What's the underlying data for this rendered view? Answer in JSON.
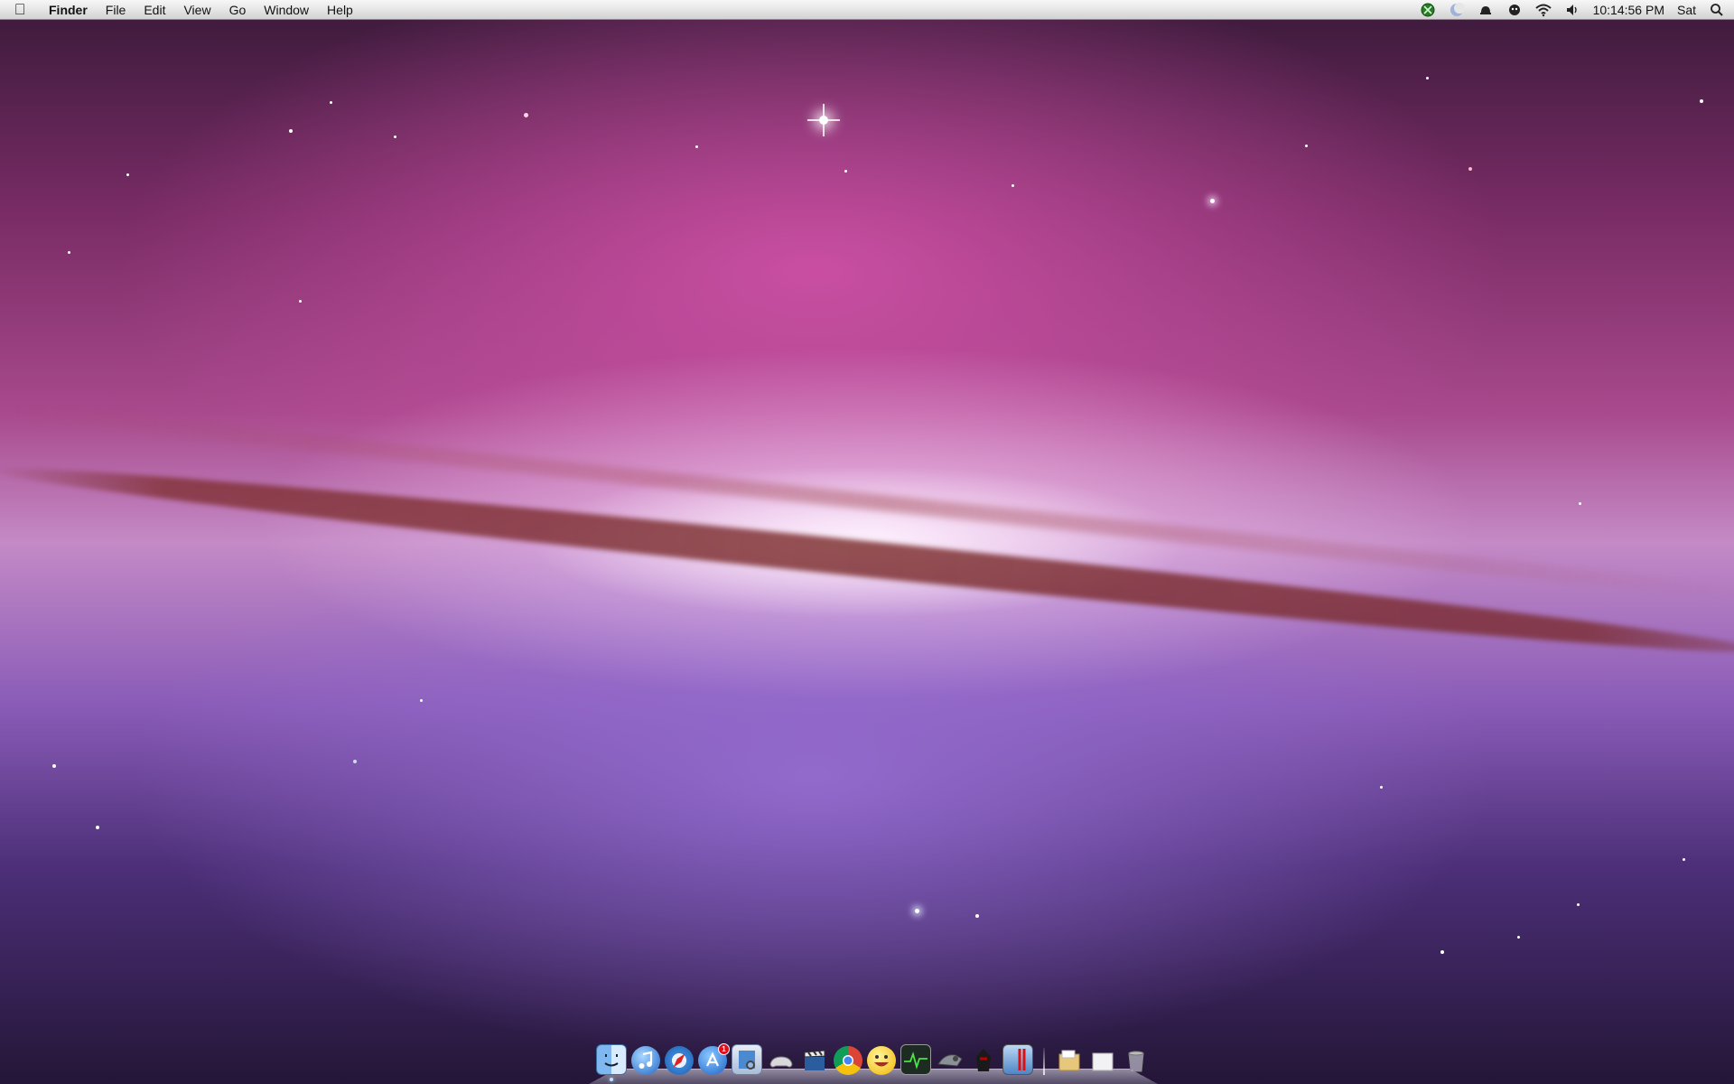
{
  "menubar": {
    "apple_icon": "apple-logo-icon",
    "app_name": "Finder",
    "menus": [
      "File",
      "Edit",
      "View",
      "Go",
      "Window",
      "Help"
    ],
    "status_icons": [
      "xbox-controller-icon",
      "moon-icon",
      "time-machine-icon",
      "skype-icon",
      "wifi-icon",
      "volume-icon"
    ],
    "clock": "10:14:56 PM",
    "day": "Sat",
    "spotlight_icon": "spotlight-search-icon"
  },
  "dock": {
    "apps": [
      {
        "name": "Finder",
        "icon": "finder-icon",
        "running": true
      },
      {
        "name": "iTunes",
        "icon": "itunes-icon",
        "running": false
      },
      {
        "name": "Safari",
        "icon": "safari-icon",
        "running": false
      },
      {
        "name": "App Store",
        "icon": "app-store-icon",
        "running": false,
        "badge": "1"
      },
      {
        "name": "Preview",
        "icon": "preview-icon",
        "running": false
      },
      {
        "name": "Game Controller",
        "icon": "game-controller-icon",
        "running": false
      },
      {
        "name": "Movie",
        "icon": "clapperboard-icon",
        "running": false
      },
      {
        "name": "Google Chrome",
        "icon": "chrome-icon",
        "running": false
      },
      {
        "name": "Adium",
        "icon": "smiley-icon",
        "running": false
      },
      {
        "name": "Activity Monitor",
        "icon": "activity-monitor-icon",
        "running": false
      },
      {
        "name": "Steam",
        "icon": "steam-icon",
        "running": false
      },
      {
        "name": "Game",
        "icon": "assassin-icon",
        "running": false
      },
      {
        "name": "Parallels",
        "icon": "parallels-icon",
        "running": false
      }
    ],
    "stacks": [
      {
        "name": "Documents",
        "icon": "documents-stack-icon"
      },
      {
        "name": "Downloads",
        "icon": "downloads-stack-icon"
      },
      {
        "name": "Trash",
        "icon": "trash-icon"
      }
    ]
  },
  "colors": {
    "sky_top": "#7a2c66",
    "galaxy_core": "#f4e6f6",
    "dust_lane": "#7a2d2d",
    "sky_bottom": "#4c2f78"
  }
}
